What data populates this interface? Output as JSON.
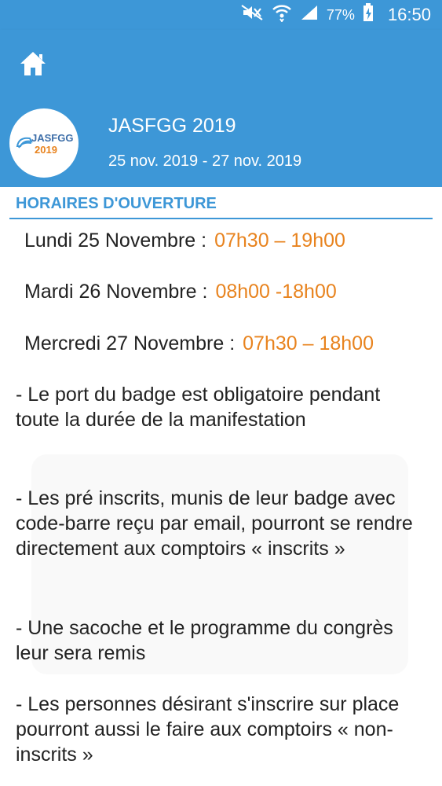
{
  "status_bar": {
    "battery": "77%",
    "time": "16:50",
    "icons": [
      "mute-icon",
      "wifi-icon",
      "signal-icon",
      "battery-charging-icon"
    ]
  },
  "app_bar": {
    "home_icon": "home-icon"
  },
  "event": {
    "logo_text": "JASFGG",
    "logo_year": "2019",
    "title": "JASFGG 2019",
    "dates": "25 nov. 2019 - 27 nov. 2019"
  },
  "section": {
    "title": "HORAIRES D'OUVERTURE"
  },
  "schedule": [
    {
      "day": "Lundi 25 Novembre :",
      "time": "07h30 – 19h00"
    },
    {
      "day": "Mardi 26 Novembre :",
      "time": "08h00 -18h00"
    },
    {
      "day": "Mercredi 27 Novembre :",
      "time": "07h30 – 18h00"
    }
  ],
  "notes": [
    " - Le port du badge est obligatoire pendant toute la durée de la manifestation",
    " - Les pré inscrits, munis de leur badge avec code-barre reçu par email, pourront se rendre directement aux comptoirs « inscrits »",
    " - Une sacoche et le programme du congrès leur sera remis",
    " - Les personnes désirant s'inscrire sur place pourront aussi le faire aux comptoirs « non-inscrits »"
  ],
  "colors": {
    "primary": "#3d97d7",
    "accent_time": "#e8831e",
    "text": "#222222"
  }
}
